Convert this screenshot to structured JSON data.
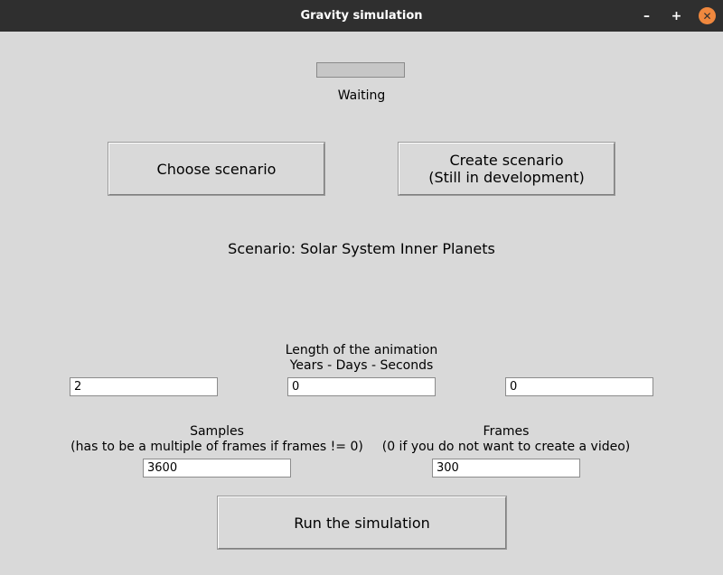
{
  "window": {
    "title": "Gravity simulation",
    "minimize_label": "–",
    "maximize_label": "+",
    "close_label": "✕"
  },
  "progress": {
    "value": 0,
    "status": "Waiting"
  },
  "buttons": {
    "choose_scenario": "Choose scenario",
    "create_scenario_line1": "Create scenario",
    "create_scenario_line2": "(Still in development)",
    "run": "Run the simulation"
  },
  "scenario": {
    "label": "Scenario: Solar System Inner Planets"
  },
  "length": {
    "title": "Length of the animation",
    "subtitle": "Years - Days - Seconds",
    "years": "2",
    "days": "0",
    "seconds": "0"
  },
  "samples": {
    "title": "Samples",
    "hint": "(has to be a multiple of frames if frames != 0)",
    "value": "3600"
  },
  "frames": {
    "title": "Frames",
    "hint": "(0 if you do not want to create a video)",
    "value": "300"
  }
}
